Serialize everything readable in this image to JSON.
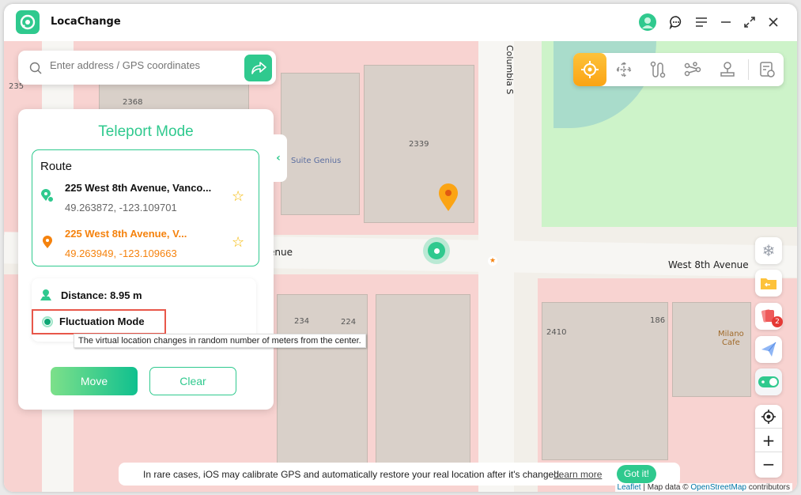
{
  "app": {
    "title": "LocaChange"
  },
  "titlebar": {
    "icons": [
      "avatar-icon",
      "chat-icon",
      "menu-icon",
      "minimize-icon",
      "fullscreen-icon",
      "close-icon"
    ]
  },
  "search": {
    "placeholder": "Enter address / GPS coordinates",
    "icon": "search-icon",
    "go_icon": "share-arrow-icon"
  },
  "panel": {
    "title": "Teleport Mode",
    "route_label": "Route",
    "start": {
      "address": "225 West 8th Avenue, Vanco...",
      "coords": "49.263872, -123.109701"
    },
    "end": {
      "address": "225 West 8th Avenue, V...",
      "coords": "49.263949, -123.109663"
    },
    "distance": "Distance: 8.95 m",
    "fluctuation_label": "Fluctuation Mode",
    "fluctuation_checked": true,
    "tooltip": "The virtual location changes in random number of meters from the center.",
    "move_label": "Move",
    "clear_label": "Clear"
  },
  "modes": [
    "teleport-mode",
    "joystick-move",
    "two-spot-mode",
    "multi-spot-mode",
    "joystick-mode",
    "history"
  ],
  "active_mode": "teleport-mode",
  "side_tools": {
    "badge_count": "2"
  },
  "map_labels": {
    "street_h": "West 8th Avenue",
    "street_h_left": "enue",
    "street_v": "Columbia S",
    "b1": "2339",
    "b2": "2368",
    "b3": "235",
    "b4": "234",
    "b5": "224",
    "b6": "2410",
    "b7": "186",
    "poi1": "Suite Genius",
    "poi2": "Milano",
    "poi3": "Cafe"
  },
  "notice": {
    "text": "In rare cases, iOS may calibrate GPS and automatically restore your real location after it's changed.",
    "link": "Learn more",
    "button": "Got it!"
  },
  "attribution": {
    "leaflet": "Leaflet",
    "mid": " | Map data © ",
    "osm": "OpenStreetMap",
    "end": " contributors"
  },
  "colors": {
    "accent": "#2fc98e",
    "orange": "#f5820d",
    "active_mode": "#fdb515"
  }
}
